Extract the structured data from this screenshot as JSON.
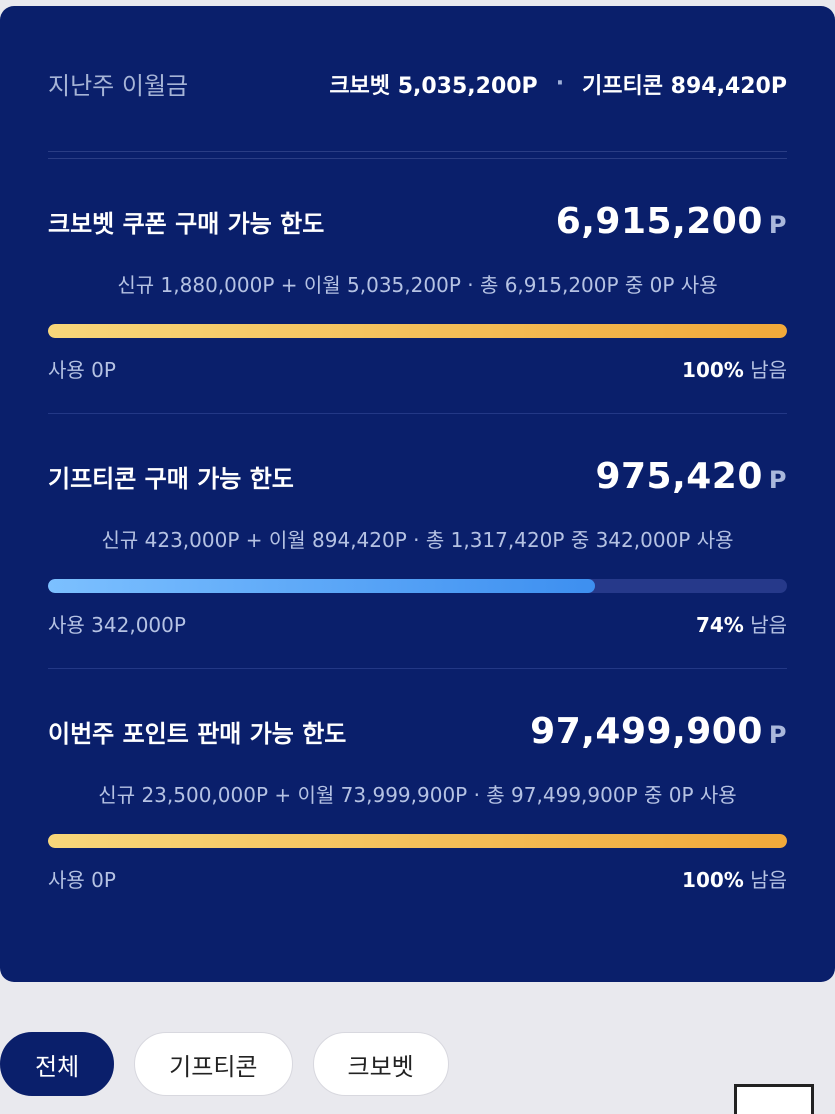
{
  "summary": {
    "label": "지난주 이월금",
    "crobet": "크보벳 5,035,200P",
    "dot": "·",
    "gifticon": "기프티콘 894,420P"
  },
  "limits": [
    {
      "title": "크보벳 쿠폰 구매 가능 한도",
      "amount": "6,915,200",
      "unit": "P",
      "desc": "신규 1,880,000P + 이월 5,035,200P · 총 6,915,200P 중 0P 사용",
      "used": "사용 0P",
      "remaining_pct": "100%",
      "remaining_suffix": "남음",
      "remaining_fraction": 1.0,
      "bar_color": "gold"
    },
    {
      "title": "기프티콘 구매 가능 한도",
      "amount": "975,420",
      "unit": "P",
      "desc": "신규 423,000P + 이월 894,420P · 총 1,317,420P 중 342,000P 사용",
      "used": "사용 342,000P",
      "remaining_pct": "74%",
      "remaining_suffix": "남음",
      "remaining_fraction": 0.74,
      "bar_color": "blue"
    },
    {
      "title": "이번주 포인트 판매 가능 한도",
      "amount": "97,499,900",
      "unit": "P",
      "desc": "신규 23,500,000P + 이월 73,999,900P · 총 97,499,900P 중 0P 사용",
      "used": "사용 0P",
      "remaining_pct": "100%",
      "remaining_suffix": "남음",
      "remaining_fraction": 1.0,
      "bar_color": "gold"
    }
  ],
  "filters": {
    "all": "전체",
    "gifticon": "기프티콘",
    "crobet": "크보벳"
  },
  "colors": {
    "card_bg": "#0a1f6b",
    "gold_start": "#f8d77a",
    "gold_end": "#f1a93a",
    "blue_start": "#7cc0ff",
    "blue_end": "#3d8ff0"
  }
}
